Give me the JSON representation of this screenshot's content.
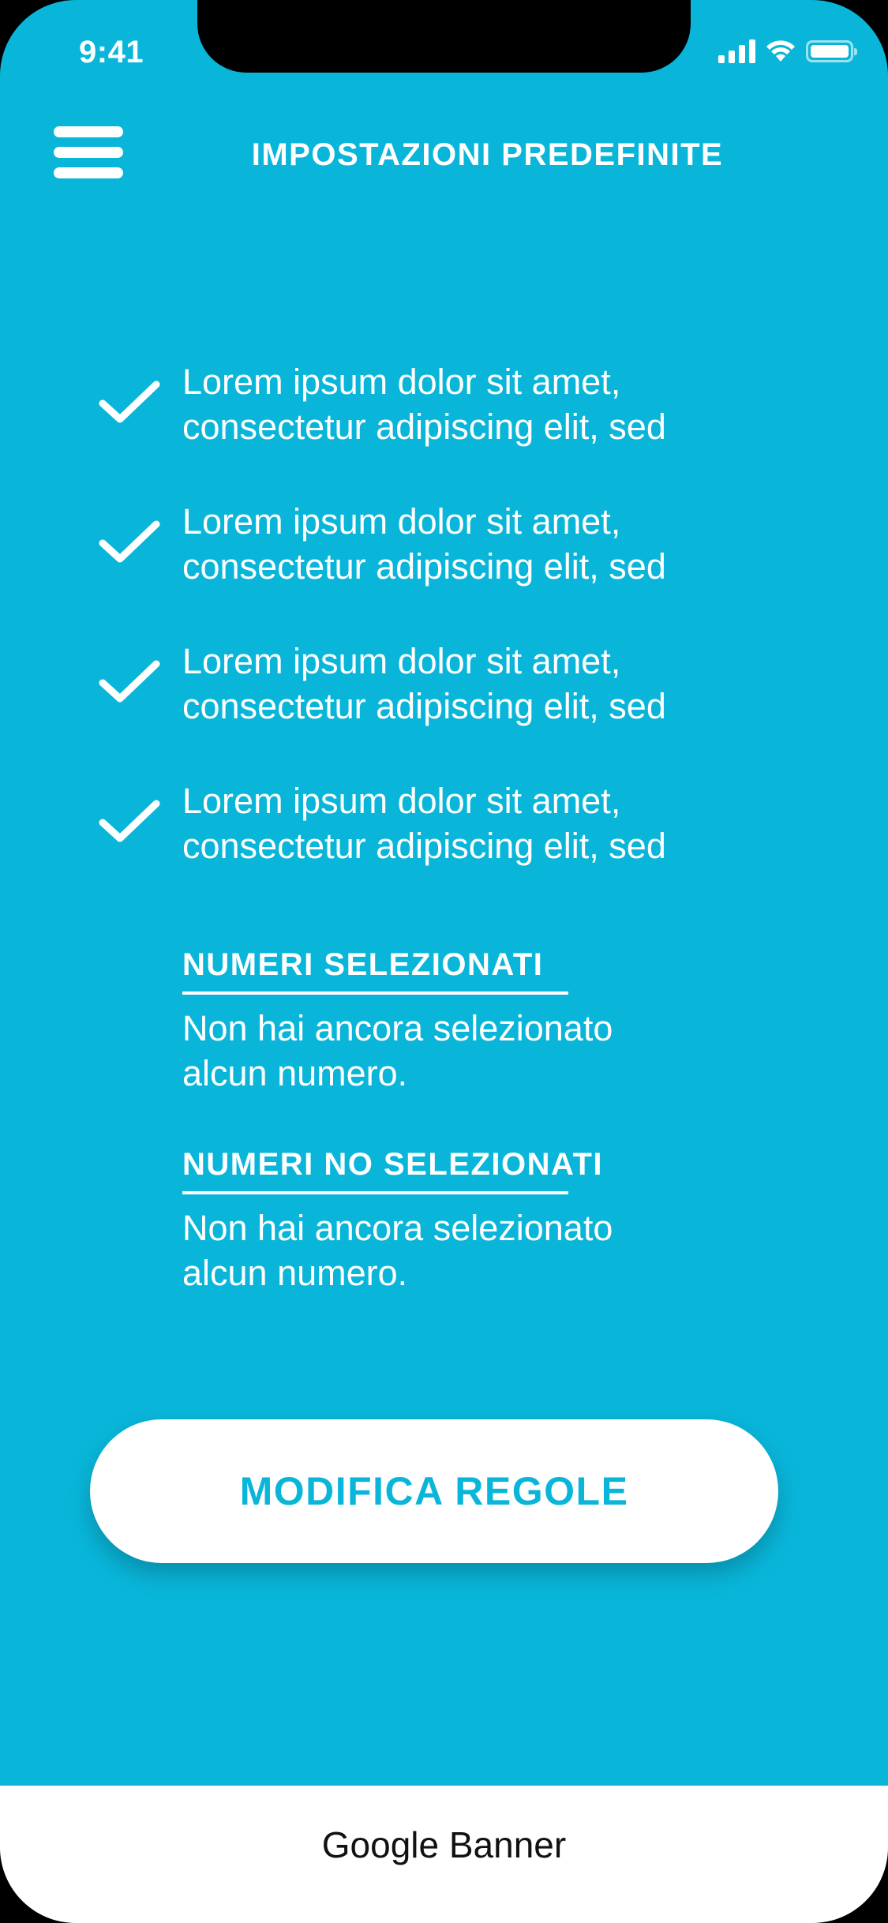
{
  "status_bar": {
    "time": "9:41",
    "icons": [
      "signal-icon",
      "wifi-icon",
      "battery-icon"
    ]
  },
  "header": {
    "menu_icon": "hamburger-menu-icon",
    "title": "IMPOSTAZIONI PREDEFINITE"
  },
  "checklist": {
    "icon": "checkmark-icon",
    "items": [
      {
        "line1": "Lorem ipsum dolor sit amet,",
        "line2": "consectetur adipiscing elit, sed"
      },
      {
        "line1": "Lorem ipsum dolor sit amet,",
        "line2": "consectetur adipiscing elit, sed"
      },
      {
        "line1": "Lorem ipsum dolor sit amet,",
        "line2": "consectetur adipiscing elit, sed"
      },
      {
        "line1": "Lorem ipsum dolor sit amet,",
        "line2": "consectetur adipiscing elit, sed"
      }
    ]
  },
  "selected_numbers": {
    "title": "NUMERI SELEZIONATI",
    "line1": "Non hai ancora selezionato",
    "line2": "alcun numero."
  },
  "unselected_numbers": {
    "title": "NUMERI NO SELEZIONATI",
    "line1": "Non hai ancora selezionato",
    "line2": "alcun numero."
  },
  "actions": {
    "edit_rules_label": "MODIFICA REGOLE"
  },
  "banner": {
    "label": "Google Banner"
  },
  "colors": {
    "background": "#09B6DA",
    "text": "#FFFFFF",
    "button_background": "#FFFFFF",
    "button_text": "#09B6DA"
  }
}
